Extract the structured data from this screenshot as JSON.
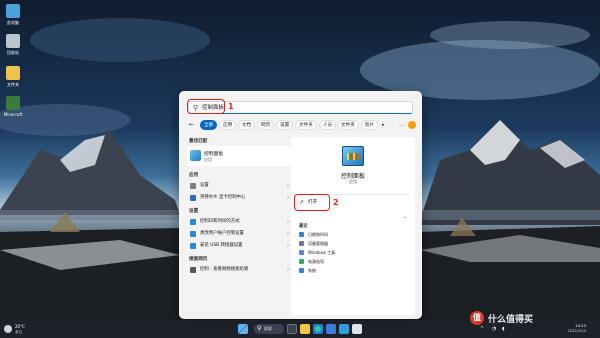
{
  "desktop": {
    "icons": [
      {
        "label": "此电脑",
        "color": "#4aa3df"
      },
      {
        "label": "回收站",
        "color": "#b9c4cf"
      },
      {
        "label": "文件夹",
        "color": "#f0c24b"
      },
      {
        "label": "Minecraft",
        "color": "#3c7a3c"
      }
    ]
  },
  "search": {
    "query": "控制面板",
    "icon": "search-icon"
  },
  "filters": {
    "back_icon": "back-arrow-icon",
    "chips": [
      "全部",
      "应用",
      "文档",
      "网页",
      "设置",
      "文件夹",
      "人员",
      "文件夹",
      "照片"
    ],
    "more_icon": "play-icon",
    "ellipsis": "…"
  },
  "left": {
    "best_match_title": "最佳匹配",
    "best_match": {
      "name": "控制面板",
      "type": "应用"
    },
    "apps_title": "应用",
    "apps": [
      {
        "label": "设置",
        "color": "#7a7f86"
      },
      {
        "label": "英特尔® 显卡控制中心",
        "color": "#2b6cbf"
      }
    ],
    "settings_title": "设置",
    "settings": [
      {
        "label": "控制日和时间的方式",
        "color": "#2d86d6"
      },
      {
        "label": "更改用户帐户控制设置",
        "color": "#2d86d6"
      },
      {
        "label": "安装 USB 转接器设置",
        "color": "#2d86d6"
      }
    ],
    "web_title": "搜索网页",
    "web": [
      {
        "label": "控制 - 查看网络搜索结果",
        "color": "#555a60"
      }
    ]
  },
  "right": {
    "name": "控制面板",
    "type": "应用",
    "open_label": "打开",
    "recent_title": "最近",
    "recent": [
      {
        "label": "日期和时间",
        "color": "#2d86d6"
      },
      {
        "label": "设备管理器",
        "color": "#6c7a89"
      },
      {
        "label": "Windows 工具",
        "color": "#4c8fd6"
      },
      {
        "label": "电源选项",
        "color": "#3aa86b"
      },
      {
        "label": "系统",
        "color": "#2d86d6"
      }
    ]
  },
  "annotations": {
    "step1": "1",
    "step2": "2",
    "color": "#e0201a"
  },
  "taskbar": {
    "weather_temp": "20°C",
    "weather_desc": "多云",
    "search_label": "搜索",
    "time": "14:23",
    "date": "2022/10/4",
    "tray_chevron": "^"
  },
  "watermark": {
    "badge": "值",
    "text": "什么值得买"
  }
}
